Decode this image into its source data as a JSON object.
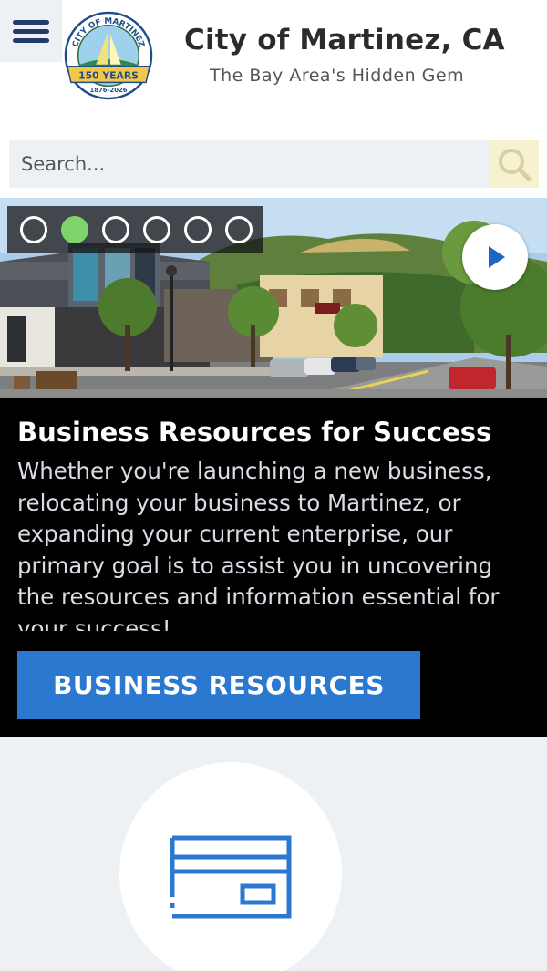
{
  "header": {
    "title": "City of Martinez, CA",
    "tagline": "The Bay Area's Hidden Gem",
    "logo": {
      "ring_top": "CITY OF MARTINEZ",
      "banner": "150 YEARS",
      "years": "1876-2026"
    }
  },
  "search": {
    "placeholder": "Search..."
  },
  "slider": {
    "slide_count": 6,
    "active_index": 1
  },
  "caption": {
    "title": "Business Resources for Success",
    "body": "Whether you're launching a new business, relocating your business to Martinez, or expanding your current enterprise, our primary goal is to assist you in uncovering the resources and information essential for your success!",
    "button_label": "BUSINESS RESOURCES"
  },
  "icons": {
    "menu": "hamburger-icon",
    "search": "magnifier-icon",
    "play": "play-icon",
    "feature": "credit-card-icon"
  },
  "colors": {
    "brand_navy": "#233a6b",
    "cta_blue": "#2a78d0",
    "active_dot": "#7fd36a",
    "search_button_bg": "#f6f2cf",
    "panel_bg": "#eef1f4"
  }
}
